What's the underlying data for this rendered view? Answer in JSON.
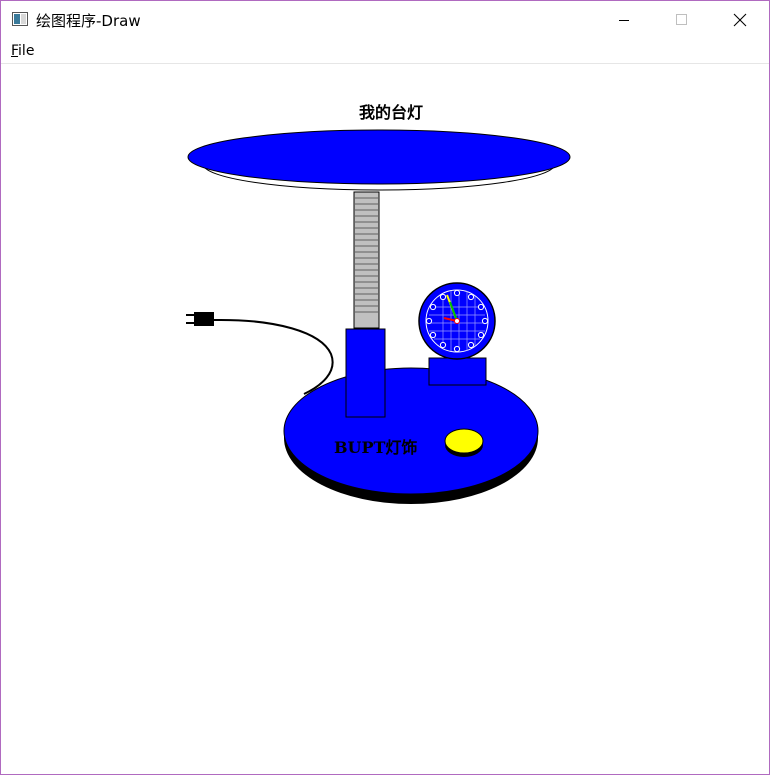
{
  "window": {
    "title": "绘图程序-Draw",
    "controls": {
      "minimize": "minimize",
      "maximize": "maximize",
      "close": "close"
    }
  },
  "menu": {
    "items": [
      {
        "label": "File"
      }
    ]
  },
  "drawing": {
    "title": "我的台灯",
    "base_label": "BUPT灯饰",
    "colors": {
      "lamp_blue": "#0000ff",
      "button_yellow": "#ffff00",
      "neck_gray": "#c0c0c0",
      "outline": "#000000",
      "hand_red": "#ff0000",
      "hand_green": "#00c000",
      "hand_yellow": "#ffff00"
    }
  }
}
